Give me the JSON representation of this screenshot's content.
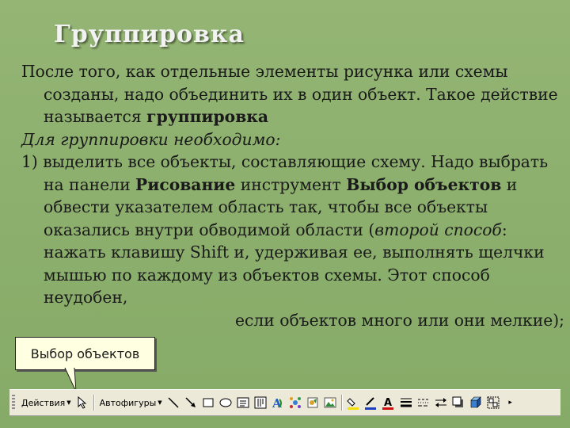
{
  "slide": {
    "title": "Группировка",
    "p1_a": "После того, как отдельные элементы рисунка или схемы созданы, надо объединить их в один объект. Такое действие называется ",
    "p1_b": "группировка",
    "p2": "Для группировки необходимо:",
    "p3_a": "1) выделить все объекты, составляющие схему. Надо выбрать на панели ",
    "p3_b": "Рисование",
    "p3_c": " инструмент ",
    "p3_d": "Выбор объектов",
    "p3_e": " и обвести указателем область так, чтобы все объекты оказались внутри обводимой области (",
    "p3_f": "второй способ",
    "p3_g": ": нажать клавишу Shift и, удерживая ее, выполнять щелчки мышью по каждому из объектов схемы. Этот способ неудобен,",
    "p3_h": "если объектов много или они мелкие);"
  },
  "tooltip": {
    "label": "Выбор объектов"
  },
  "toolbar": {
    "actions_label": "Действия",
    "autoshapes_label": "Автофигуры"
  },
  "colors": {
    "background": "#8fb16f",
    "title": "#f2f2f2",
    "tooltip_bg": "#ffffe1",
    "toolbar_bg": "#ece9d8"
  },
  "icons": [
    "select-objects-icon",
    "line-icon",
    "arrow-icon",
    "rectangle-icon",
    "oval-icon",
    "textbox-icon",
    "vertical-text-icon",
    "wordart-icon",
    "diagram-icon",
    "clipart-icon",
    "picture-icon",
    "fill-color-icon",
    "line-color-icon",
    "font-color-icon",
    "line-style-icon",
    "dash-style-icon",
    "arrow-style-icon",
    "shadow-icon",
    "3d-icon",
    "group-icon",
    "toolbar-options-icon"
  ]
}
